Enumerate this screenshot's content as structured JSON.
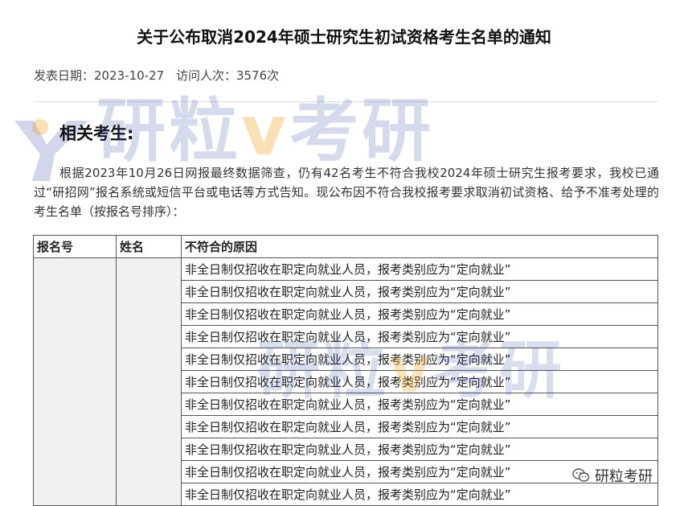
{
  "notice": {
    "title": "关于公布取消2024年硕士研究生初试资格考生名单的通知",
    "publish_date": "发表日期：2023-10-27",
    "visits": "访问人次：3576次",
    "heading": "相关考生:",
    "paragraph": "根据2023年10月26日网报最终数据筛查，仍有42名考生不符合我校2024年硕士研究生报考要求，我校已通过“研招网”报名系统或短信平台或电话等方式告知。现公布因不符合我校报考要求取消初试资格、给予不准考处理的考生名单（按报名号排序）："
  },
  "table": {
    "headers": [
      "报名号",
      "姓名",
      "不符合的原因"
    ],
    "reasons": [
      "非全日制仅招收在职定向就业人员，报考类别应为“定向就业”",
      "非全日制仅招收在职定向就业人员，报考类别应为“定向就业”",
      "非全日制仅招收在职定向就业人员，报考类别应为“定向就业”",
      "非全日制仅招收在职定向就业人员，报考类别应为“定向就业”",
      "非全日制仅招收在职定向就业人员，报考类别应为“定向就业”",
      "非全日制仅招收在职定向就业人员，报考类别应为“定向就业”",
      "非全日制仅招收在职定向就业人员，报考类别应为“定向就业”",
      "非全日制仅招收在职定向就业人员，报考类别应为“定向就业”",
      "非全日制仅招收在职定向就业人员，报考类别应为“定向就业”",
      "非全日制仅招收在职定向就业人员，报考类别应为“定向就业”",
      "非全日制仅招收在职定向就业人员，报考类别应为“定向就业”"
    ]
  },
  "watermark": {
    "text_main": "研粒考研",
    "wechat_label": "研粒考研",
    "brand_blue": "#2d46a0",
    "brand_orange": "#f0a528"
  }
}
